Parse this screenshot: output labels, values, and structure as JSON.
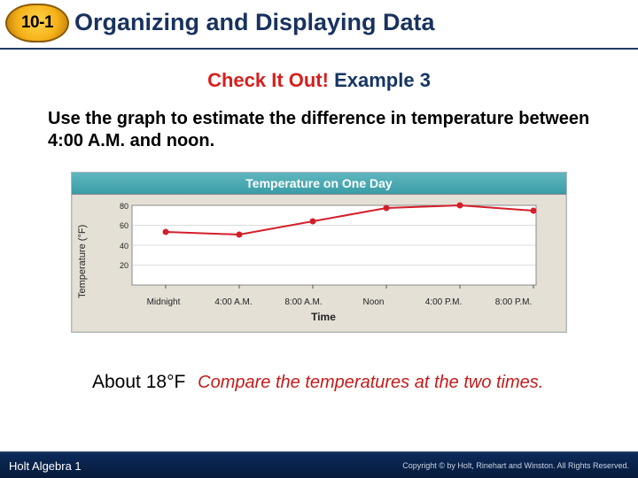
{
  "header": {
    "section_number": "10-1",
    "title": "Organizing and Displaying Data"
  },
  "check": {
    "label": "Check It Out!",
    "example": "Example 3"
  },
  "prompt": "Use the graph to estimate the difference in temperature between 4:00 A.M. and noon.",
  "chart_data": {
    "type": "line",
    "title": "Temperature on One Day",
    "ylabel": "Temperature (°F)",
    "xlabel": "Time",
    "categories": [
      "Midnight",
      "4:00 A.M.",
      "8:00 A.M.",
      "Noon",
      "4:00 P.M.",
      "8:00 P.M."
    ],
    "values": [
      60,
      58,
      68,
      78,
      80,
      76
    ],
    "ylim": [
      20,
      80
    ],
    "yticks": [
      20,
      40,
      60,
      80
    ]
  },
  "answer": {
    "value": "About 18°F",
    "hint": "Compare the temperatures at the two times."
  },
  "footer": {
    "book": "Holt Algebra 1",
    "copyright": "Copyright © by Holt, Rinehart and Winston. All Rights Reserved."
  }
}
